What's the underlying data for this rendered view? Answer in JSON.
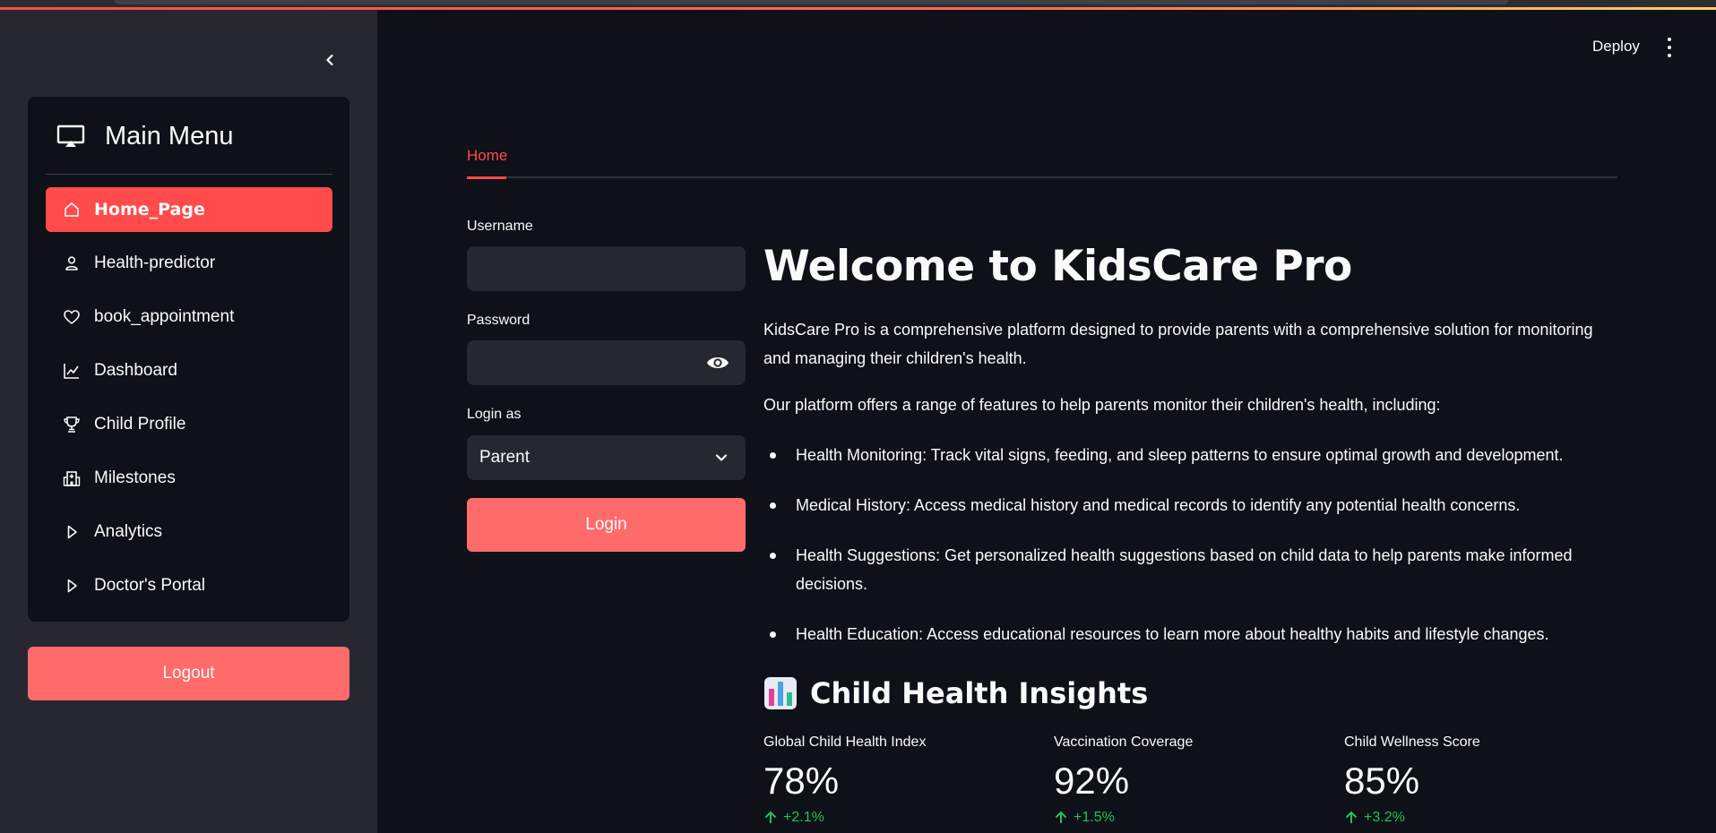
{
  "sidebar": {
    "menu_title": "Main Menu",
    "items": [
      {
        "label": "Home_Page",
        "icon": "house-icon",
        "active": true
      },
      {
        "label": "Health-predictor",
        "icon": "person-icon"
      },
      {
        "label": "book_appointment",
        "icon": "heart-icon"
      },
      {
        "label": "Dashboard",
        "icon": "graph-up-icon"
      },
      {
        "label": "Child Profile",
        "icon": "trophy-icon"
      },
      {
        "label": "Milestones",
        "icon": "hospital-icon"
      },
      {
        "label": "Analytics",
        "icon": "play-triangle-icon"
      },
      {
        "label": "Doctor's Portal",
        "icon": "play-triangle-icon"
      }
    ],
    "logout_label": "Logout"
  },
  "header": {
    "deploy_label": "Deploy"
  },
  "tabs": [
    {
      "label": "Home",
      "active": true
    }
  ],
  "login_form": {
    "username_label": "Username",
    "username_value": "",
    "password_label": "Password",
    "password_value": "",
    "role_label": "Login as",
    "role_value": "Parent",
    "submit_label": "Login"
  },
  "welcome": {
    "title": "Welcome to KidsCare Pro",
    "intro": "KidsCare Pro is a comprehensive platform designed to provide parents with a comprehensive solution for monitoring and managing their children's health.",
    "features_intro": "Our platform offers a range of features to help parents monitor their children's health, including:",
    "features": [
      "Health Monitoring: Track vital signs, feeding, and sleep patterns to ensure optimal growth and development.",
      "Medical History: Access medical history and medical records to identify any potential health concerns.",
      "Health Suggestions: Get personalized health suggestions based on child data to help parents make informed decisions.",
      "Health Education: Access educational resources to learn more about healthy habits and lifestyle changes."
    ]
  },
  "insights": {
    "title": "Child Health Insights",
    "icon": "bar-chart-emoji-icon",
    "metrics": [
      {
        "label": "Global Child Health Index",
        "value": "78%",
        "delta": "+2.1%"
      },
      {
        "label": "Vaccination Coverage",
        "value": "92%",
        "delta": "+1.5%"
      },
      {
        "label": "Child Wellness Score",
        "value": "85%",
        "delta": "+3.2%"
      }
    ]
  },
  "colors": {
    "accent": "#ff4b4b",
    "button": "#ff6b6b",
    "positive": "#21c354",
    "background": "#0e1117",
    "sidebar": "#262730"
  }
}
